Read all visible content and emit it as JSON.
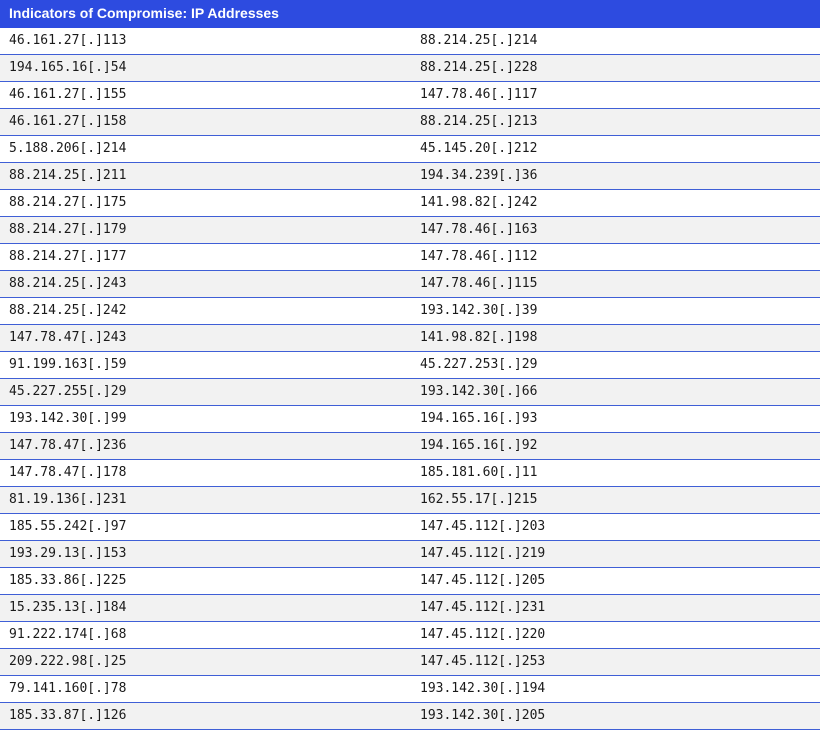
{
  "table": {
    "title": "Indicators of Compromise: IP Addresses",
    "rows": [
      [
        "46.161.27[.]113",
        "88.214.25[.]214"
      ],
      [
        "194.165.16[.]54",
        "88.214.25[.]228"
      ],
      [
        "46.161.27[.]155",
        "147.78.46[.]117"
      ],
      [
        "46.161.27[.]158",
        "88.214.25[.]213"
      ],
      [
        "5.188.206[.]214",
        "45.145.20[.]212"
      ],
      [
        "88.214.25[.]211",
        "194.34.239[.]36"
      ],
      [
        "88.214.27[.]175",
        "141.98.82[.]242"
      ],
      [
        "88.214.27[.]179",
        "147.78.46[.]163"
      ],
      [
        "88.214.27[.]177",
        "147.78.46[.]112"
      ],
      [
        "88.214.25[.]243",
        "147.78.46[.]115"
      ],
      [
        "88.214.25[.]242",
        "193.142.30[.]39"
      ],
      [
        "147.78.47[.]243",
        "141.98.82[.]198"
      ],
      [
        "91.199.163[.]59",
        "45.227.253[.]29"
      ],
      [
        "45.227.255[.]29",
        "193.142.30[.]66"
      ],
      [
        "193.142.30[.]99",
        "194.165.16[.]93"
      ],
      [
        "147.78.47[.]236",
        "194.165.16[.]92"
      ],
      [
        "147.78.47[.]178",
        "185.181.60[.]11"
      ],
      [
        "81.19.136[.]231",
        "162.55.17[.]215"
      ],
      [
        "185.55.242[.]97",
        "147.45.112[.]203"
      ],
      [
        "193.29.13[.]153",
        "147.45.112[.]219"
      ],
      [
        "185.33.86[.]225",
        "147.45.112[.]205"
      ],
      [
        "15.235.13[.]184",
        "147.45.112[.]231"
      ],
      [
        "91.222.174[.]68",
        "147.45.112[.]220"
      ],
      [
        "209.222.98[.]25",
        "147.45.112[.]253"
      ],
      [
        "79.141.160[.]78",
        "193.142.30[.]194"
      ],
      [
        "185.33.87[.]126",
        "193.142.30[.]205"
      ]
    ]
  }
}
